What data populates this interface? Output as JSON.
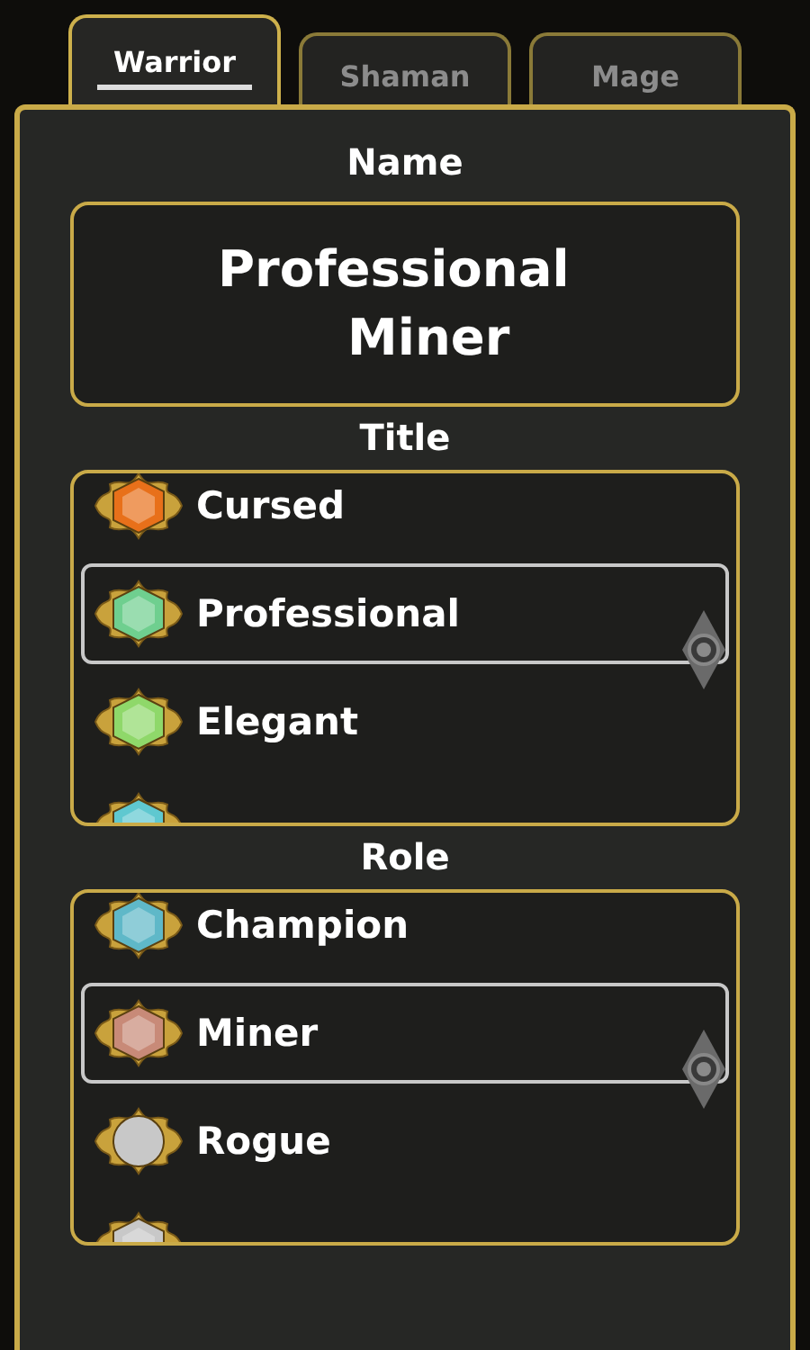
{
  "tabs": [
    {
      "label": "Warrior",
      "selected": true
    },
    {
      "label": "Shaman",
      "selected": false
    },
    {
      "label": "Mage",
      "selected": false
    }
  ],
  "name": {
    "heading": "Name",
    "lines": [
      "Professional",
      "Miner"
    ]
  },
  "lists": [
    {
      "heading": "Title",
      "items": [
        {
          "label": "Cursed",
          "kind": "hexagon",
          "color": "#e8701a",
          "selected": false
        },
        {
          "label": "Professional",
          "kind": "hexagon",
          "color": "#6fcf8f",
          "selected": true
        },
        {
          "label": "Elegant",
          "kind": "hexagon",
          "color": "#8fd86a",
          "selected": false
        },
        {
          "kind": "hexagon",
          "color": "#5fc8d0",
          "selected": false
        }
      ]
    },
    {
      "heading": "Role",
      "items": [
        {
          "label": "Champion",
          "kind": "hexagon",
          "color": "#5fb8c8",
          "selected": false
        },
        {
          "label": "Miner",
          "kind": "hexagon",
          "color": "#c88a78",
          "selected": true
        },
        {
          "label": "Rogue",
          "kind": "round",
          "color": "#c8c8c8",
          "selected": false
        },
        {
          "kind": "hexagon",
          "color": "#c8c8c8",
          "selected": false
        }
      ]
    }
  ]
}
